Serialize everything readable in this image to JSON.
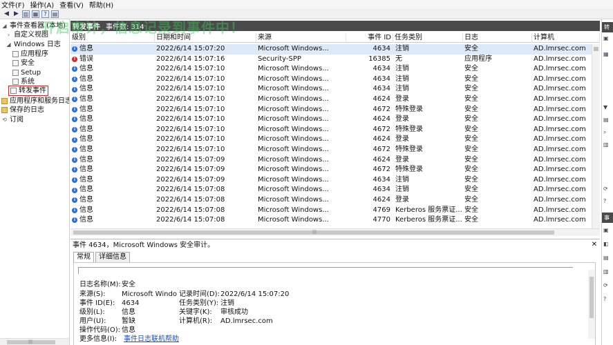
{
  "menu": [
    "文件(F)",
    "操作(A)",
    "查看(V)",
    "帮助(H)"
  ],
  "overlay_text": "开启审计，信息记录到事件中！",
  "tree": {
    "root": "事件查看器 (本地)",
    "custom_views": "自定义视图",
    "windows_logs": "Windows 日志",
    "application": "应用程序",
    "security": "安全",
    "setup": "Setup",
    "system": "系统",
    "forwarded": "转发事件",
    "apps_services": "应用程序和服务日志",
    "saved_logs": "保存的日志",
    "subscriptions": "订阅"
  },
  "panel": {
    "title": "转发事件",
    "count": "事件数: 314"
  },
  "columns": [
    "级别",
    "日期和时间",
    "来源",
    "事件 ID",
    "任务类别",
    "日志",
    "计算机"
  ],
  "rows": [
    {
      "level": "信息",
      "type": "info",
      "time": "2022/6/14 15:07:20",
      "source": "Microsoft Windows...",
      "id": "4634",
      "task": "注销",
      "log": "安全",
      "computer": "AD.lmrsec.com",
      "selected": true
    },
    {
      "level": "错误",
      "type": "error",
      "time": "2022/6/14 15:07:16",
      "source": "Security-SPP",
      "id": "16385",
      "task": "无",
      "log": "应用程序",
      "computer": "AD.lmrsec.com"
    },
    {
      "level": "信息",
      "type": "info",
      "time": "2022/6/14 15:07:10",
      "source": "Microsoft Windows...",
      "id": "4634",
      "task": "注销",
      "log": "安全",
      "computer": "AD.lmrsec.com"
    },
    {
      "level": "信息",
      "type": "info",
      "time": "2022/6/14 15:07:10",
      "source": "Microsoft Windows...",
      "id": "4634",
      "task": "注销",
      "log": "安全",
      "computer": "AD.lmrsec.com"
    },
    {
      "level": "信息",
      "type": "info",
      "time": "2022/6/14 15:07:10",
      "source": "Microsoft Windows...",
      "id": "4634",
      "task": "注销",
      "log": "安全",
      "computer": "AD.lmrsec.com"
    },
    {
      "level": "信息",
      "type": "info",
      "time": "2022/6/14 15:07:10",
      "source": "Microsoft Windows...",
      "id": "4624",
      "task": "登录",
      "log": "安全",
      "computer": "AD.lmrsec.com"
    },
    {
      "level": "信息",
      "type": "info",
      "time": "2022/6/14 15:07:10",
      "source": "Microsoft Windows...",
      "id": "4672",
      "task": "特殊登录",
      "log": "安全",
      "computer": "AD.lmrsec.com"
    },
    {
      "level": "信息",
      "type": "info",
      "time": "2022/6/14 15:07:10",
      "source": "Microsoft Windows...",
      "id": "4624",
      "task": "登录",
      "log": "安全",
      "computer": "AD.lmrsec.com"
    },
    {
      "level": "信息",
      "type": "info",
      "time": "2022/6/14 15:07:10",
      "source": "Microsoft Windows...",
      "id": "4672",
      "task": "特殊登录",
      "log": "安全",
      "computer": "AD.lmrsec.com"
    },
    {
      "level": "信息",
      "type": "info",
      "time": "2022/6/14 15:07:10",
      "source": "Microsoft Windows...",
      "id": "4624",
      "task": "登录",
      "log": "安全",
      "computer": "AD.lmrsec.com"
    },
    {
      "level": "信息",
      "type": "info",
      "time": "2022/6/14 15:07:10",
      "source": "Microsoft Windows...",
      "id": "4672",
      "task": "特殊登录",
      "log": "安全",
      "computer": "AD.lmrsec.com"
    },
    {
      "level": "信息",
      "type": "info",
      "time": "2022/6/14 15:07:09",
      "source": "Microsoft Windows...",
      "id": "4624",
      "task": "登录",
      "log": "安全",
      "computer": "AD.lmrsec.com"
    },
    {
      "level": "信息",
      "type": "info",
      "time": "2022/6/14 15:07:09",
      "source": "Microsoft Windows...",
      "id": "4672",
      "task": "特殊登录",
      "log": "安全",
      "computer": "AD.lmrsec.com"
    },
    {
      "level": "信息",
      "type": "info",
      "time": "2022/6/14 15:07:09",
      "source": "Microsoft Windows...",
      "id": "4634",
      "task": "注销",
      "log": "安全",
      "computer": "AD.lmrsec.com"
    },
    {
      "level": "信息",
      "type": "info",
      "time": "2022/6/14 15:07:08",
      "source": "Microsoft Windows...",
      "id": "4634",
      "task": "注销",
      "log": "安全",
      "computer": "AD.lmrsec.com"
    },
    {
      "level": "信息",
      "type": "info",
      "time": "2022/6/14 15:07:08",
      "source": "Microsoft Windows...",
      "id": "4624",
      "task": "登录",
      "log": "安全",
      "computer": "AD.lmrsec.com"
    },
    {
      "level": "信息",
      "type": "info",
      "time": "2022/6/14 15:07:08",
      "source": "Microsoft Windows...",
      "id": "4769",
      "task": "Kerberos 服务票证...",
      "log": "安全",
      "computer": "AD.lmrsec.com"
    },
    {
      "level": "信息",
      "type": "info",
      "time": "2022/6/14 15:07:08",
      "source": "Microsoft Windows...",
      "id": "4770",
      "task": "Kerberos 服务票证...",
      "log": "安全",
      "computer": "AD.lmrsec.com"
    }
  ],
  "detail": {
    "title": "事件 4634，Microsoft Windows 安全审计。",
    "tab_general": "常规",
    "tab_details": "详细信息",
    "log_name_label": "日志名称(M):",
    "log_name": "安全",
    "source_label": "来源(S):",
    "source": "Microsoft Windo",
    "recorded_label": "记录时间(D):",
    "recorded": "2022/6/14 15:07:20",
    "event_id_label": "事件 ID(E):",
    "event_id": "4634",
    "task_label": "任务类别(Y):",
    "task": "注销",
    "level_label": "级别(L):",
    "level": "信息",
    "keywords_label": "关键字(K):",
    "keywords": "审核成功",
    "user_label": "用户(U):",
    "user": "暂缺",
    "computer_label": "计算机(R):",
    "computer": "AD.lmrsec.com",
    "opcode_label": "操作代码(O):",
    "opcode": "信息",
    "more_info_label": "更多信息(I):",
    "more_info": "事件日志联机帮助"
  },
  "actions": {
    "header_1": "转",
    "header_2": "事"
  },
  "colors": {
    "header_bg": "#4a4a4a",
    "info_icon": "#2b6fd6",
    "error_icon": "#d12a2a",
    "highlight_border": "#dd2222",
    "link": "#1a4fc4"
  }
}
